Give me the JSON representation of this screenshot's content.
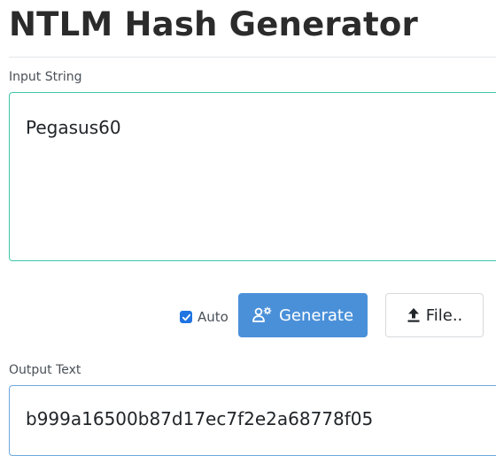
{
  "header": {
    "title": "NTLM Hash Generator"
  },
  "input": {
    "label": "Input String",
    "value": "Pegasus60"
  },
  "controls": {
    "auto_label": "Auto",
    "auto_checked": true,
    "generate_label": "Generate",
    "generate_icon": "user-gear-icon",
    "file_label": "File..",
    "file_icon": "upload-icon"
  },
  "output": {
    "label": "Output Text",
    "value": "b999a16500b87d17ec7f2e2a68778f05"
  },
  "colors": {
    "primary_button": "#4a90d9",
    "checkbox": "#1f74e2",
    "input_border": "#3fc6ad",
    "output_border": "#6fa8dc"
  }
}
